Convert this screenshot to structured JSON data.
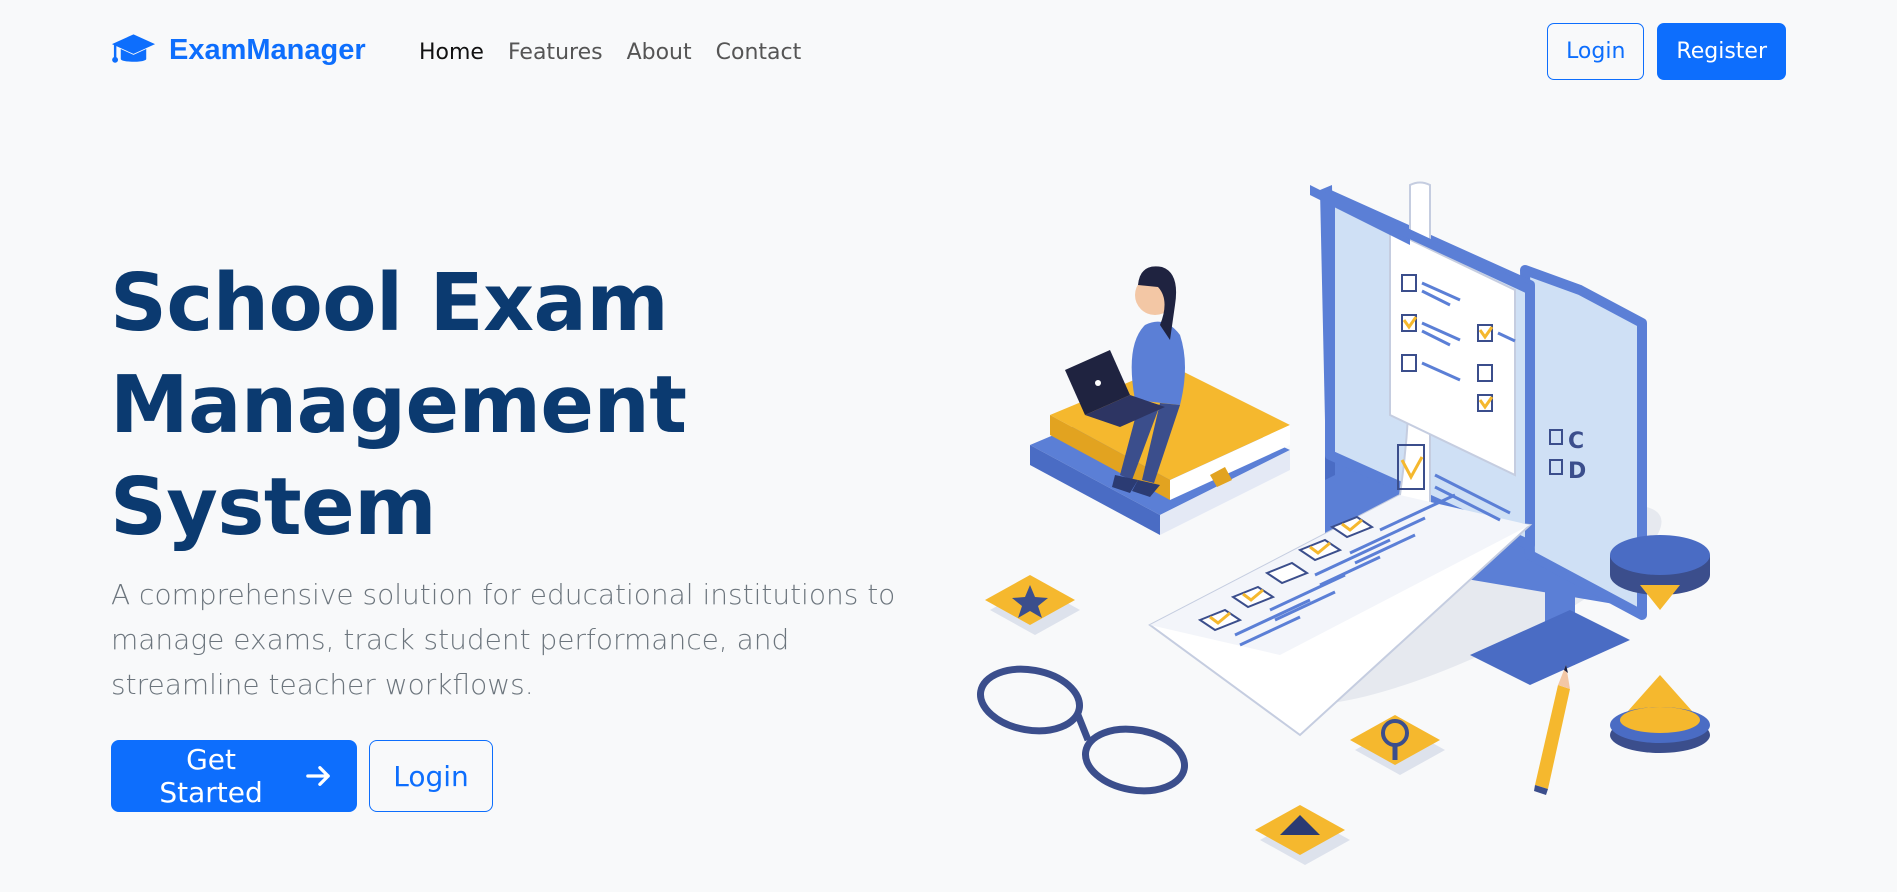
{
  "navbar": {
    "brand_name": "ExamManager",
    "links": [
      {
        "label": "Home",
        "active": true
      },
      {
        "label": "Features",
        "active": false
      },
      {
        "label": "About",
        "active": false
      },
      {
        "label": "Contact",
        "active": false
      }
    ],
    "login_label": "Login",
    "register_label": "Register"
  },
  "hero": {
    "title_lines": [
      "School Exam",
      "Management",
      "System"
    ],
    "subtitle": "A comprehensive solution for educational institutions to manage exams, track student performance, and streamline teacher workflows.",
    "get_started_label": "Get Started",
    "login_label": "Login"
  },
  "illustration": {
    "monitor_letters": [
      "C",
      "D"
    ]
  },
  "colors": {
    "primary": "#0d6efd",
    "title": "#0b3a70",
    "muted": "#6c757d",
    "background": "#f8f9fa",
    "illustration_blue": "#5b7fd6",
    "illustration_yellow": "#f5b82e"
  }
}
